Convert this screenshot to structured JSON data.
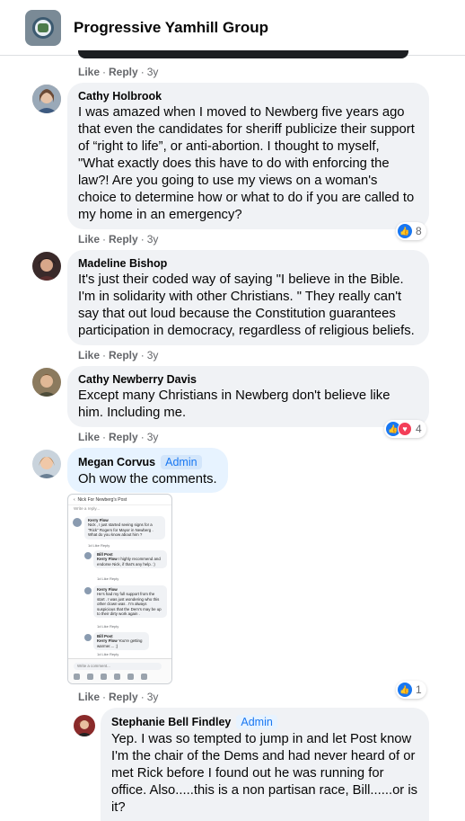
{
  "header": {
    "group_name": "Progressive Yamhill Group"
  },
  "actions": {
    "like": "Like",
    "reply": "Reply",
    "sep": "·"
  },
  "comments": [
    {
      "actions_time": "3y"
    },
    {
      "author": "Cathy Holbrook",
      "text": "I was amazed when I moved to Newberg five years ago that even the candidates for sheriff publicize their support of “right to life”, or anti-abortion. I thought to myself, \"What exactly does this have to do with enforcing the law?! Are you going to use my views on a woman's choice to determine how or what to do if you are called to my home in an emergency?",
      "reaction_count": "8",
      "time": "3y"
    },
    {
      "author": "Madeline Bishop",
      "text": "It's just their coded way of saying \"I believe in the Bible. I'm in solidarity with other Christians. \" They really can't say that out loud because the Constitution guarantees participation in democracy, regardless of religious beliefs.",
      "time": "3y"
    },
    {
      "author": "Cathy Newberry Davis",
      "text": "Except many Christians in Newberg don't believe like him. Including me.",
      "reaction_count": "4",
      "time": "3y"
    },
    {
      "author": "Megan Corvus",
      "badge": "Admin",
      "text": "Oh wow the comments.",
      "reaction_count": "1",
      "time": "3y"
    },
    {
      "author": "Stephanie Bell Findley",
      "badge": "Admin",
      "text": "Yep. I was so tempted to jump in and let Post know I'm the chair of the Dems and had never heard of or met Rick before I found out he was running for office. Also.....this is a non partisan race, Bill......or is it?"
    }
  ],
  "screenshot": {
    "title": "Nick For Newberg's Post",
    "write_top": "Write a reply...",
    "c1_author": "Kerry Flow",
    "c1_text": "Nick , I just started seeing signs for a \"Rick\" Rogers for Mayor in Newberg . What do you know about him ?",
    "c1_act": "1d   Like   Reply",
    "c2_author": "Bill Post",
    "c2_mention": "Kerry Flow",
    "c2_text": "I highly recommend and endorse Nick, if that's any help. :)",
    "c2_act": "1d   Like   Reply",
    "c3_author": "Kerry Flow",
    "c3_text": "He's had my full support from the start . I was just wondering who this other clown was . I'm always suspicious that the Dem's may be up to their dirty work again .",
    "c3_act": "1d   Like   Reply",
    "c4_author": "Bill Post",
    "c4_mention": "Kerry Flow",
    "c4_text": "You're getting warmer.... ;)",
    "c4_act": "1d   Like   Reply",
    "write_bottom": "Write a comment..."
  }
}
